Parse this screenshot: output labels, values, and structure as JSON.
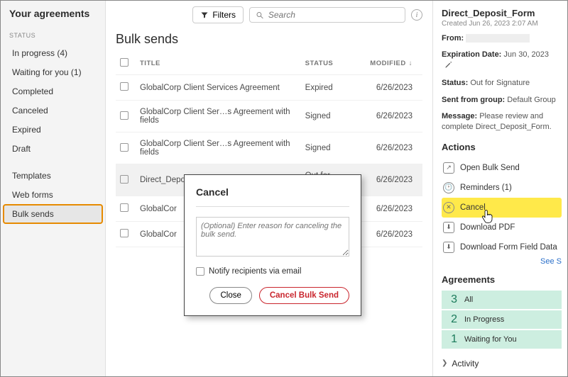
{
  "sidebar": {
    "title": "Your agreements",
    "section_label": "STATUS",
    "items": [
      {
        "label": "In progress (4)"
      },
      {
        "label": "Waiting for you (1)"
      },
      {
        "label": "Completed"
      },
      {
        "label": "Canceled"
      },
      {
        "label": "Expired"
      },
      {
        "label": "Draft"
      }
    ],
    "items2": [
      {
        "label": "Templates"
      },
      {
        "label": "Web forms"
      },
      {
        "label": "Bulk sends"
      }
    ]
  },
  "toolbar": {
    "filters": "Filters",
    "search_placeholder": "Search"
  },
  "main": {
    "heading": "Bulk sends",
    "columns": {
      "title": "TITLE",
      "status": "STATUS",
      "modified": "MODIFIED"
    },
    "rows": [
      {
        "title": "GlobalCorp Client Services Agreement",
        "status": "Expired",
        "modified": "6/26/2023"
      },
      {
        "title": "GlobalCorp Client Ser…s Agreement with fields",
        "status": "Signed",
        "modified": "6/26/2023"
      },
      {
        "title": "GlobalCorp Client Ser…s Agreement with fields",
        "status": "Signed",
        "modified": "6/26/2023"
      },
      {
        "title": "Direct_Deposit_Form",
        "status": "Out for signature",
        "modified": "6/26/2023",
        "selected": true
      },
      {
        "title": "GlobalCor",
        "status": "",
        "modified": "6/26/2023"
      },
      {
        "title": "GlobalCor",
        "status": "",
        "modified": "6/26/2023"
      }
    ]
  },
  "modal": {
    "title": "Cancel",
    "reason_placeholder": "(Optional) Enter reason for canceling the bulk send.",
    "notify_label": "Notify recipients via email",
    "close": "Close",
    "confirm": "Cancel Bulk Send"
  },
  "details": {
    "name": "Direct_Deposit_Form",
    "created": "Created Jun 26, 2023 2:07 AM",
    "from_label": "From:",
    "exp_label": "Expiration Date:",
    "exp_val": "Jun 30, 2023",
    "status_label": "Status:",
    "status_val": "Out for Signature",
    "group_label": "Sent from group:",
    "group_val": "Default Group",
    "msg_label": "Message:",
    "msg_val": "Please review and complete Direct_Deposit_Form.",
    "actions_heading": "Actions",
    "actions": {
      "open": "Open Bulk Send",
      "reminders": "Reminders (1)",
      "cancel": "Cancel",
      "download_pdf": "Download PDF",
      "download_data": "Download Form Field Data"
    },
    "see": "See S",
    "agreements_heading": "Agreements",
    "stats": [
      {
        "n": "3",
        "label": "All"
      },
      {
        "n": "2",
        "label": "In Progress"
      },
      {
        "n": "1",
        "label": "Waiting for You"
      }
    ],
    "activity": "Activity"
  }
}
